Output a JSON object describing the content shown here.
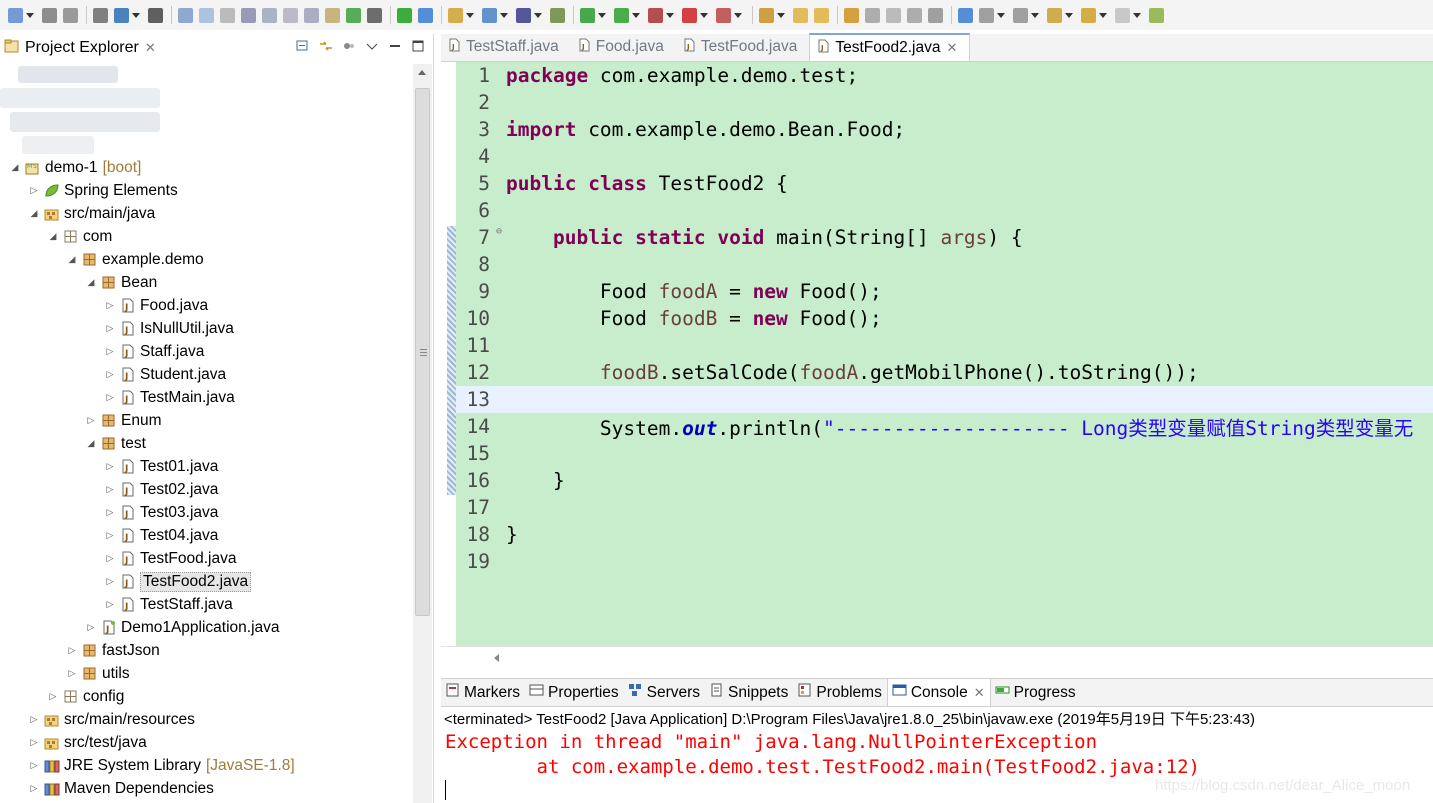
{
  "toolbar": {
    "icons": [
      "new-icon",
      "save-icon",
      "save-all-icon",
      "print-icon",
      "open-console-icon",
      "terminal-icon",
      "skip-breakpoints-icon",
      "resume-icon",
      "suspend-icon",
      "stop-icon",
      "disconnect-icon",
      "step-into-icon",
      "step-over-icon",
      "step-return-icon",
      "drop-to-frame-icon",
      "use-step-filters-icon",
      "spring-boot-icon",
      "toggle-block-icon",
      "refresh-icon",
      "new-java-project-icon",
      "new-package-icon",
      "open-type-icon",
      "debug-icon",
      "run-icon",
      "coverage-icon",
      "stop-server-icon",
      "external-tools-icon",
      "open-task-icon",
      "open-folder-icon",
      "open-resource-icon",
      "search-icon",
      "annotation-icon",
      "mark-occurrences-icon",
      "show-whitespace-icon",
      "word-wrap-icon",
      "globe-icon",
      "next-annotation-icon",
      "prev-annotation-icon",
      "last-edit-icon",
      "back-icon",
      "forward-icon",
      "pin-icon"
    ]
  },
  "explorer": {
    "title": "Project Explorer",
    "tree": [
      {
        "indent": 0,
        "twisty": "open",
        "icon": "project-icon",
        "label": "demo-1",
        "deco": "[boot]"
      },
      {
        "indent": 1,
        "twisty": "closed",
        "icon": "spring-leaf-icon",
        "label": "Spring Elements"
      },
      {
        "indent": 1,
        "twisty": "open",
        "icon": "source-folder-icon",
        "label": "src/main/java"
      },
      {
        "indent": 2,
        "twisty": "open",
        "icon": "package-empty-icon",
        "label": "com"
      },
      {
        "indent": 3,
        "twisty": "open",
        "icon": "package-icon",
        "label": "example.demo"
      },
      {
        "indent": 4,
        "twisty": "open",
        "icon": "package-icon",
        "label": "Bean"
      },
      {
        "indent": 5,
        "twisty": "closed",
        "icon": "java-file-icon",
        "label": "Food.java"
      },
      {
        "indent": 5,
        "twisty": "closed",
        "icon": "java-file-icon",
        "label": "IsNullUtil.java"
      },
      {
        "indent": 5,
        "twisty": "closed",
        "icon": "java-file-icon",
        "label": "Staff.java"
      },
      {
        "indent": 5,
        "twisty": "closed",
        "icon": "java-file-icon",
        "label": "Student.java"
      },
      {
        "indent": 5,
        "twisty": "closed",
        "icon": "java-file-icon",
        "label": "TestMain.java"
      },
      {
        "indent": 4,
        "twisty": "closed",
        "icon": "package-icon",
        "label": "Enum"
      },
      {
        "indent": 4,
        "twisty": "open",
        "icon": "package-icon",
        "label": "test"
      },
      {
        "indent": 5,
        "twisty": "closed",
        "icon": "java-file-icon",
        "label": "Test01.java"
      },
      {
        "indent": 5,
        "twisty": "closed",
        "icon": "java-file-icon",
        "label": "Test02.java"
      },
      {
        "indent": 5,
        "twisty": "closed",
        "icon": "java-file-icon",
        "label": "Test03.java"
      },
      {
        "indent": 5,
        "twisty": "closed",
        "icon": "java-file-icon",
        "label": "Test04.java"
      },
      {
        "indent": 5,
        "twisty": "closed",
        "icon": "java-file-icon",
        "label": "TestFood.java"
      },
      {
        "indent": 5,
        "twisty": "closed",
        "icon": "java-file-icon",
        "label": "TestFood2.java",
        "selected": true
      },
      {
        "indent": 5,
        "twisty": "closed",
        "icon": "java-file-icon",
        "label": "TestStaff.java"
      },
      {
        "indent": 4,
        "twisty": "closed",
        "icon": "spring-java-file-icon",
        "label": "Demo1Application.java"
      },
      {
        "indent": 3,
        "twisty": "closed",
        "icon": "package-icon",
        "label": "fastJson"
      },
      {
        "indent": 3,
        "twisty": "closed",
        "icon": "package-icon",
        "label": "utils"
      },
      {
        "indent": 2,
        "twisty": "closed",
        "icon": "package-empty-icon",
        "label": "config"
      },
      {
        "indent": 1,
        "twisty": "closed",
        "icon": "source-folder-icon",
        "label": "src/main/resources"
      },
      {
        "indent": 1,
        "twisty": "closed",
        "icon": "source-folder-icon",
        "label": "src/test/java"
      },
      {
        "indent": 1,
        "twisty": "closed",
        "icon": "library-icon",
        "label": "JRE System Library",
        "deco": "[JavaSE-1.8]"
      },
      {
        "indent": 1,
        "twisty": "closed",
        "icon": "library-icon",
        "label": "Maven Dependencies"
      }
    ]
  },
  "editor": {
    "tabs": [
      {
        "label": "TestStaff.java",
        "active": false
      },
      {
        "label": "Food.java",
        "active": false
      },
      {
        "label": "TestFood.java",
        "active": false
      },
      {
        "label": "TestFood2.java",
        "active": true
      }
    ],
    "current_line": 13,
    "lines": [
      {
        "n": "1",
        "parts": [
          {
            "t": "package",
            "c": "kw"
          },
          {
            "t": " com.example.demo.test;",
            "c": ""
          }
        ]
      },
      {
        "n": "2",
        "parts": []
      },
      {
        "n": "3",
        "parts": [
          {
            "t": "import",
            "c": "kw"
          },
          {
            "t": " com.example.demo.Bean.Food;",
            "c": ""
          }
        ]
      },
      {
        "n": "4",
        "parts": []
      },
      {
        "n": "5",
        "parts": [
          {
            "t": "public",
            "c": "kw"
          },
          {
            "t": " ",
            "c": ""
          },
          {
            "t": "class",
            "c": "kw"
          },
          {
            "t": " TestFood2 {",
            "c": ""
          }
        ]
      },
      {
        "n": "6",
        "parts": []
      },
      {
        "n": "7",
        "fold": true,
        "parts": [
          {
            "t": "    ",
            "c": ""
          },
          {
            "t": "public",
            "c": "kw"
          },
          {
            "t": " ",
            "c": ""
          },
          {
            "t": "static",
            "c": "kw"
          },
          {
            "t": " ",
            "c": ""
          },
          {
            "t": "void",
            "c": "kw"
          },
          {
            "t": " main(String[] ",
            "c": ""
          },
          {
            "t": "args",
            "c": "var"
          },
          {
            "t": ") {",
            "c": ""
          }
        ]
      },
      {
        "n": "8",
        "parts": []
      },
      {
        "n": "9",
        "parts": [
          {
            "t": "        Food ",
            "c": ""
          },
          {
            "t": "foodA",
            "c": "var"
          },
          {
            "t": " = ",
            "c": ""
          },
          {
            "t": "new",
            "c": "kw"
          },
          {
            "t": " Food();",
            "c": ""
          }
        ]
      },
      {
        "n": "10",
        "parts": [
          {
            "t": "        Food ",
            "c": ""
          },
          {
            "t": "foodB",
            "c": "var"
          },
          {
            "t": " = ",
            "c": ""
          },
          {
            "t": "new",
            "c": "kw"
          },
          {
            "t": " Food();",
            "c": ""
          }
        ]
      },
      {
        "n": "11",
        "parts": []
      },
      {
        "n": "12",
        "parts": [
          {
            "t": "        ",
            "c": ""
          },
          {
            "t": "foodB",
            "c": "var"
          },
          {
            "t": ".setSalCode(",
            "c": ""
          },
          {
            "t": "foodA",
            "c": "var"
          },
          {
            "t": ".getMobilPhone().toString());",
            "c": ""
          }
        ]
      },
      {
        "n": "13",
        "parts": []
      },
      {
        "n": "14",
        "parts": [
          {
            "t": "        System.",
            "c": ""
          },
          {
            "t": "out",
            "c": "fld"
          },
          {
            "t": ".println(",
            "c": ""
          },
          {
            "t": "\"-------------------- Long类型变量赋值String类型变量无",
            "c": "str"
          }
        ]
      },
      {
        "n": "15",
        "parts": []
      },
      {
        "n": "16",
        "parts": [
          {
            "t": "    }",
            "c": ""
          }
        ]
      },
      {
        "n": "17",
        "parts": []
      },
      {
        "n": "18",
        "parts": [
          {
            "t": "}",
            "c": ""
          }
        ]
      },
      {
        "n": "19",
        "parts": []
      }
    ]
  },
  "bottom_panel": {
    "tabs": [
      {
        "label": "Markers",
        "icon": "markers-icon",
        "active": false
      },
      {
        "label": "Properties",
        "icon": "properties-icon",
        "active": false
      },
      {
        "label": "Servers",
        "icon": "servers-icon",
        "active": false
      },
      {
        "label": "Snippets",
        "icon": "snippets-icon",
        "active": false
      },
      {
        "label": "Problems",
        "icon": "problems-icon",
        "active": false
      },
      {
        "label": "Console",
        "icon": "console-icon",
        "active": true
      },
      {
        "label": "Progress",
        "icon": "progress-icon",
        "active": false
      }
    ],
    "console": {
      "status": "<terminated> TestFood2 [Java Application] D:\\Program Files\\Java\\jre1.8.0_25\\bin\\javaw.exe (2019年5月19日 下午5:23:43)",
      "lines": [
        "Exception in thread \"main\" java.lang.NullPointerException",
        "\tat com.example.demo.test.TestFood2.main(TestFood2.java:12)"
      ]
    }
  },
  "watermark": "https://blog.csdn.net/dear_Alice_moon",
  "colors": {
    "editor_bg": "#c7edcc",
    "current_line": "#e8f2fe",
    "keyword": "#7f0055",
    "local_var": "#6a3e3e",
    "string": "#2a00ff",
    "static_field": "#0000c0",
    "error": "#ff0000"
  }
}
